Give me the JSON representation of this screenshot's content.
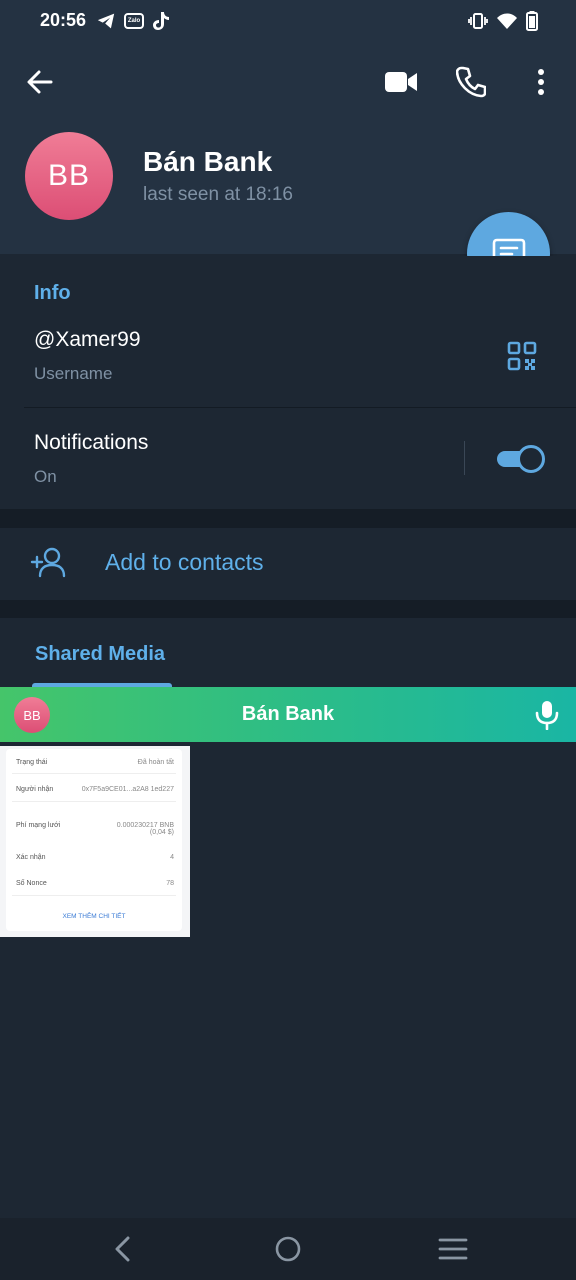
{
  "status_bar": {
    "time": "20:56",
    "left_icons": [
      "telegram-icon",
      "zalo-icon",
      "tiktok-icon"
    ],
    "zalo_label": "Zalo",
    "right_icons": [
      "vibrate-icon",
      "wifi-icon",
      "battery-icon"
    ]
  },
  "header": {
    "avatar_initials": "BB",
    "name": "Bán Bank",
    "status": "last seen at 18:16",
    "actions": [
      "back-icon",
      "video-call-icon",
      "phone-icon",
      "more-icon"
    ]
  },
  "info": {
    "section_title": "Info",
    "username": "@Xamer99",
    "username_label": "Username",
    "notifications_label": "Notifications",
    "notifications_value": "On",
    "notifications_enabled": true
  },
  "add_contact": {
    "label": "Add to contacts"
  },
  "shared_media": {
    "title": "Shared Media"
  },
  "call_bar": {
    "avatar_initials": "BB",
    "name": "Bán Bank"
  },
  "thumbnail": {
    "rows": [
      {
        "label": "Trạng thái",
        "value": "Đã hoàn tất"
      },
      {
        "label": "Người nhận",
        "value": "0x7F5a9CE01...a2A8 1ed227"
      },
      {
        "label": "Phí mạng lưới",
        "value": "0.000230217 BNB (0,04 $)"
      },
      {
        "label": "Xác nhận",
        "value": "4"
      },
      {
        "label": "Số Nonce",
        "value": "78"
      }
    ],
    "link": "XEM THÊM CHI TIẾT"
  },
  "colors": {
    "background": "#1d2733",
    "header": "#243242",
    "accent": "#5ea8e0",
    "avatar": "#e35d80",
    "call_bar_start": "#45c56a",
    "call_bar_end": "#1ab6a4"
  }
}
